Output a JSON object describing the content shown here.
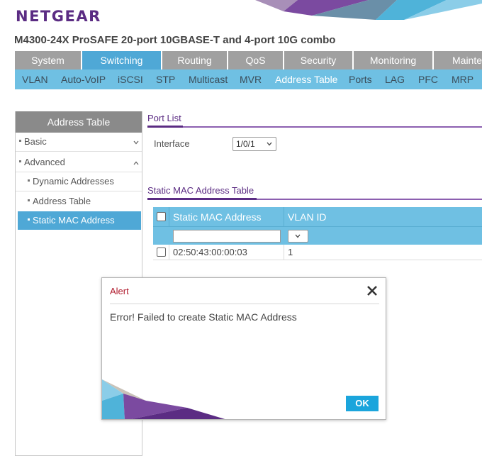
{
  "header": {
    "logo": "NETGEAR",
    "product_title": "M4300-24X ProSAFE 20-port 10GBASE-T and 4-port 10G combo"
  },
  "main_tabs": [
    {
      "label": "System",
      "active": false
    },
    {
      "label": "Switching",
      "active": true
    },
    {
      "label": "Routing",
      "active": false
    },
    {
      "label": "QoS",
      "active": false
    },
    {
      "label": "Security",
      "active": false
    },
    {
      "label": "Monitoring",
      "active": false
    },
    {
      "label": "Mainter",
      "active": false
    }
  ],
  "sub_tabs": [
    {
      "label": "VLAN",
      "active": false
    },
    {
      "label": "Auto-VoIP",
      "active": false
    },
    {
      "label": "iSCSI",
      "active": false
    },
    {
      "label": "STP",
      "active": false
    },
    {
      "label": "Multicast",
      "active": false
    },
    {
      "label": "MVR",
      "active": false
    },
    {
      "label": "Address Table",
      "active": true
    },
    {
      "label": "Ports",
      "active": false
    },
    {
      "label": "LAG",
      "active": false
    },
    {
      "label": "PFC",
      "active": false
    },
    {
      "label": "MRP",
      "active": false
    }
  ],
  "nav": {
    "header": "Address Table",
    "basic": "Basic",
    "advanced": "Advanced",
    "dynamic_addresses": "Dynamic Addresses",
    "address_table": "Address Table",
    "static_mac_address": "Static MAC Address"
  },
  "port_list": {
    "title": "Port List",
    "interface_label": "Interface",
    "interface_value": "1/0/1"
  },
  "static_table": {
    "title": "Static MAC Address Table",
    "columns": [
      "Static MAC Address",
      "VLAN ID"
    ],
    "filter_mac_value": "",
    "rows": [
      {
        "mac": "02:50:43:00:00:03",
        "vlan": "1"
      }
    ]
  },
  "alert": {
    "title": "Alert",
    "message": "Error! Failed to create Static MAC Address",
    "ok_label": "OK"
  },
  "colors": {
    "brand_purple": "#5b2c83",
    "tab_active_blue": "#4fa8d6",
    "subnav_blue": "#6fc0e3",
    "alert_red": "#b01c2e",
    "ok_blue": "#1ba5dc"
  }
}
